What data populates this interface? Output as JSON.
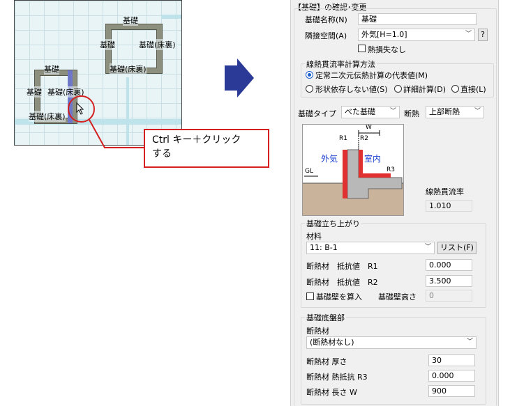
{
  "canvas": {
    "labels": [
      "基礎",
      "基礎",
      "基礎(床裏)",
      "基礎(床裏)",
      "基礎",
      "基礎",
      "基礎(床裏)",
      "基礎(床裏)"
    ]
  },
  "callout": {
    "line1": "Ctrl キー＋クリック",
    "line2": "する"
  },
  "dialog": {
    "header": "【基礎】の確認･変更",
    "name_label": "基礎名称(N)",
    "name_value": "基礎",
    "adjacent_label": "隣接空間(A)",
    "adjacent_value": "外気[H=1.0]",
    "help_button": "?",
    "heat_loss_none": "熱損失なし",
    "method_group": "線熱貫流率計算方法",
    "method_options": {
      "opt1": "定常二次元伝熱計算の代表値(M)",
      "opt2": "形状依存しない値(S)",
      "opt3": "詳細計算(D)",
      "opt4": "直接(L)"
    },
    "foundation_type_label": "基礎タイプ",
    "foundation_type_value": "べた基礎",
    "insulation_label": "断熱",
    "insulation_value": "上部断熱",
    "diagram": {
      "w": "W",
      "r1": "R1",
      "r2": "R2",
      "r3": "R3",
      "outside": "外気",
      "inside": "室内",
      "gl": "GL"
    },
    "linear_label": "線熱貫流率",
    "linear_value": "1.010",
    "rise_group": "基礎立ち上がり",
    "material_label": "材料",
    "material_value": "11: B-1",
    "list_button": "リスト(F)",
    "r1_label": "断熱材　抵抗値　R1",
    "r1_value": "0.000",
    "r2_label": "断熱材　抵抗値　R2",
    "r2_value": "3.500",
    "wall_include": "基礎壁を算入",
    "wall_height_label": "基礎壁高さ",
    "wall_height_value": "0",
    "slab_group": "基礎底盤部",
    "insulation_mat_label": "断熱材",
    "insulation_mat_value": "(断熱材なし)",
    "thickness_label": "断熱材 厚さ",
    "thickness_value": "30",
    "r3_label": "断熱材 熱抵抗 R3",
    "r3_value": "0.000",
    "length_label": "断熱材 長さ W",
    "length_value": "900"
  },
  "colors": {
    "accent": "#1a5fd0",
    "highlight": "#d42020",
    "arrow": "#2b3a96"
  }
}
